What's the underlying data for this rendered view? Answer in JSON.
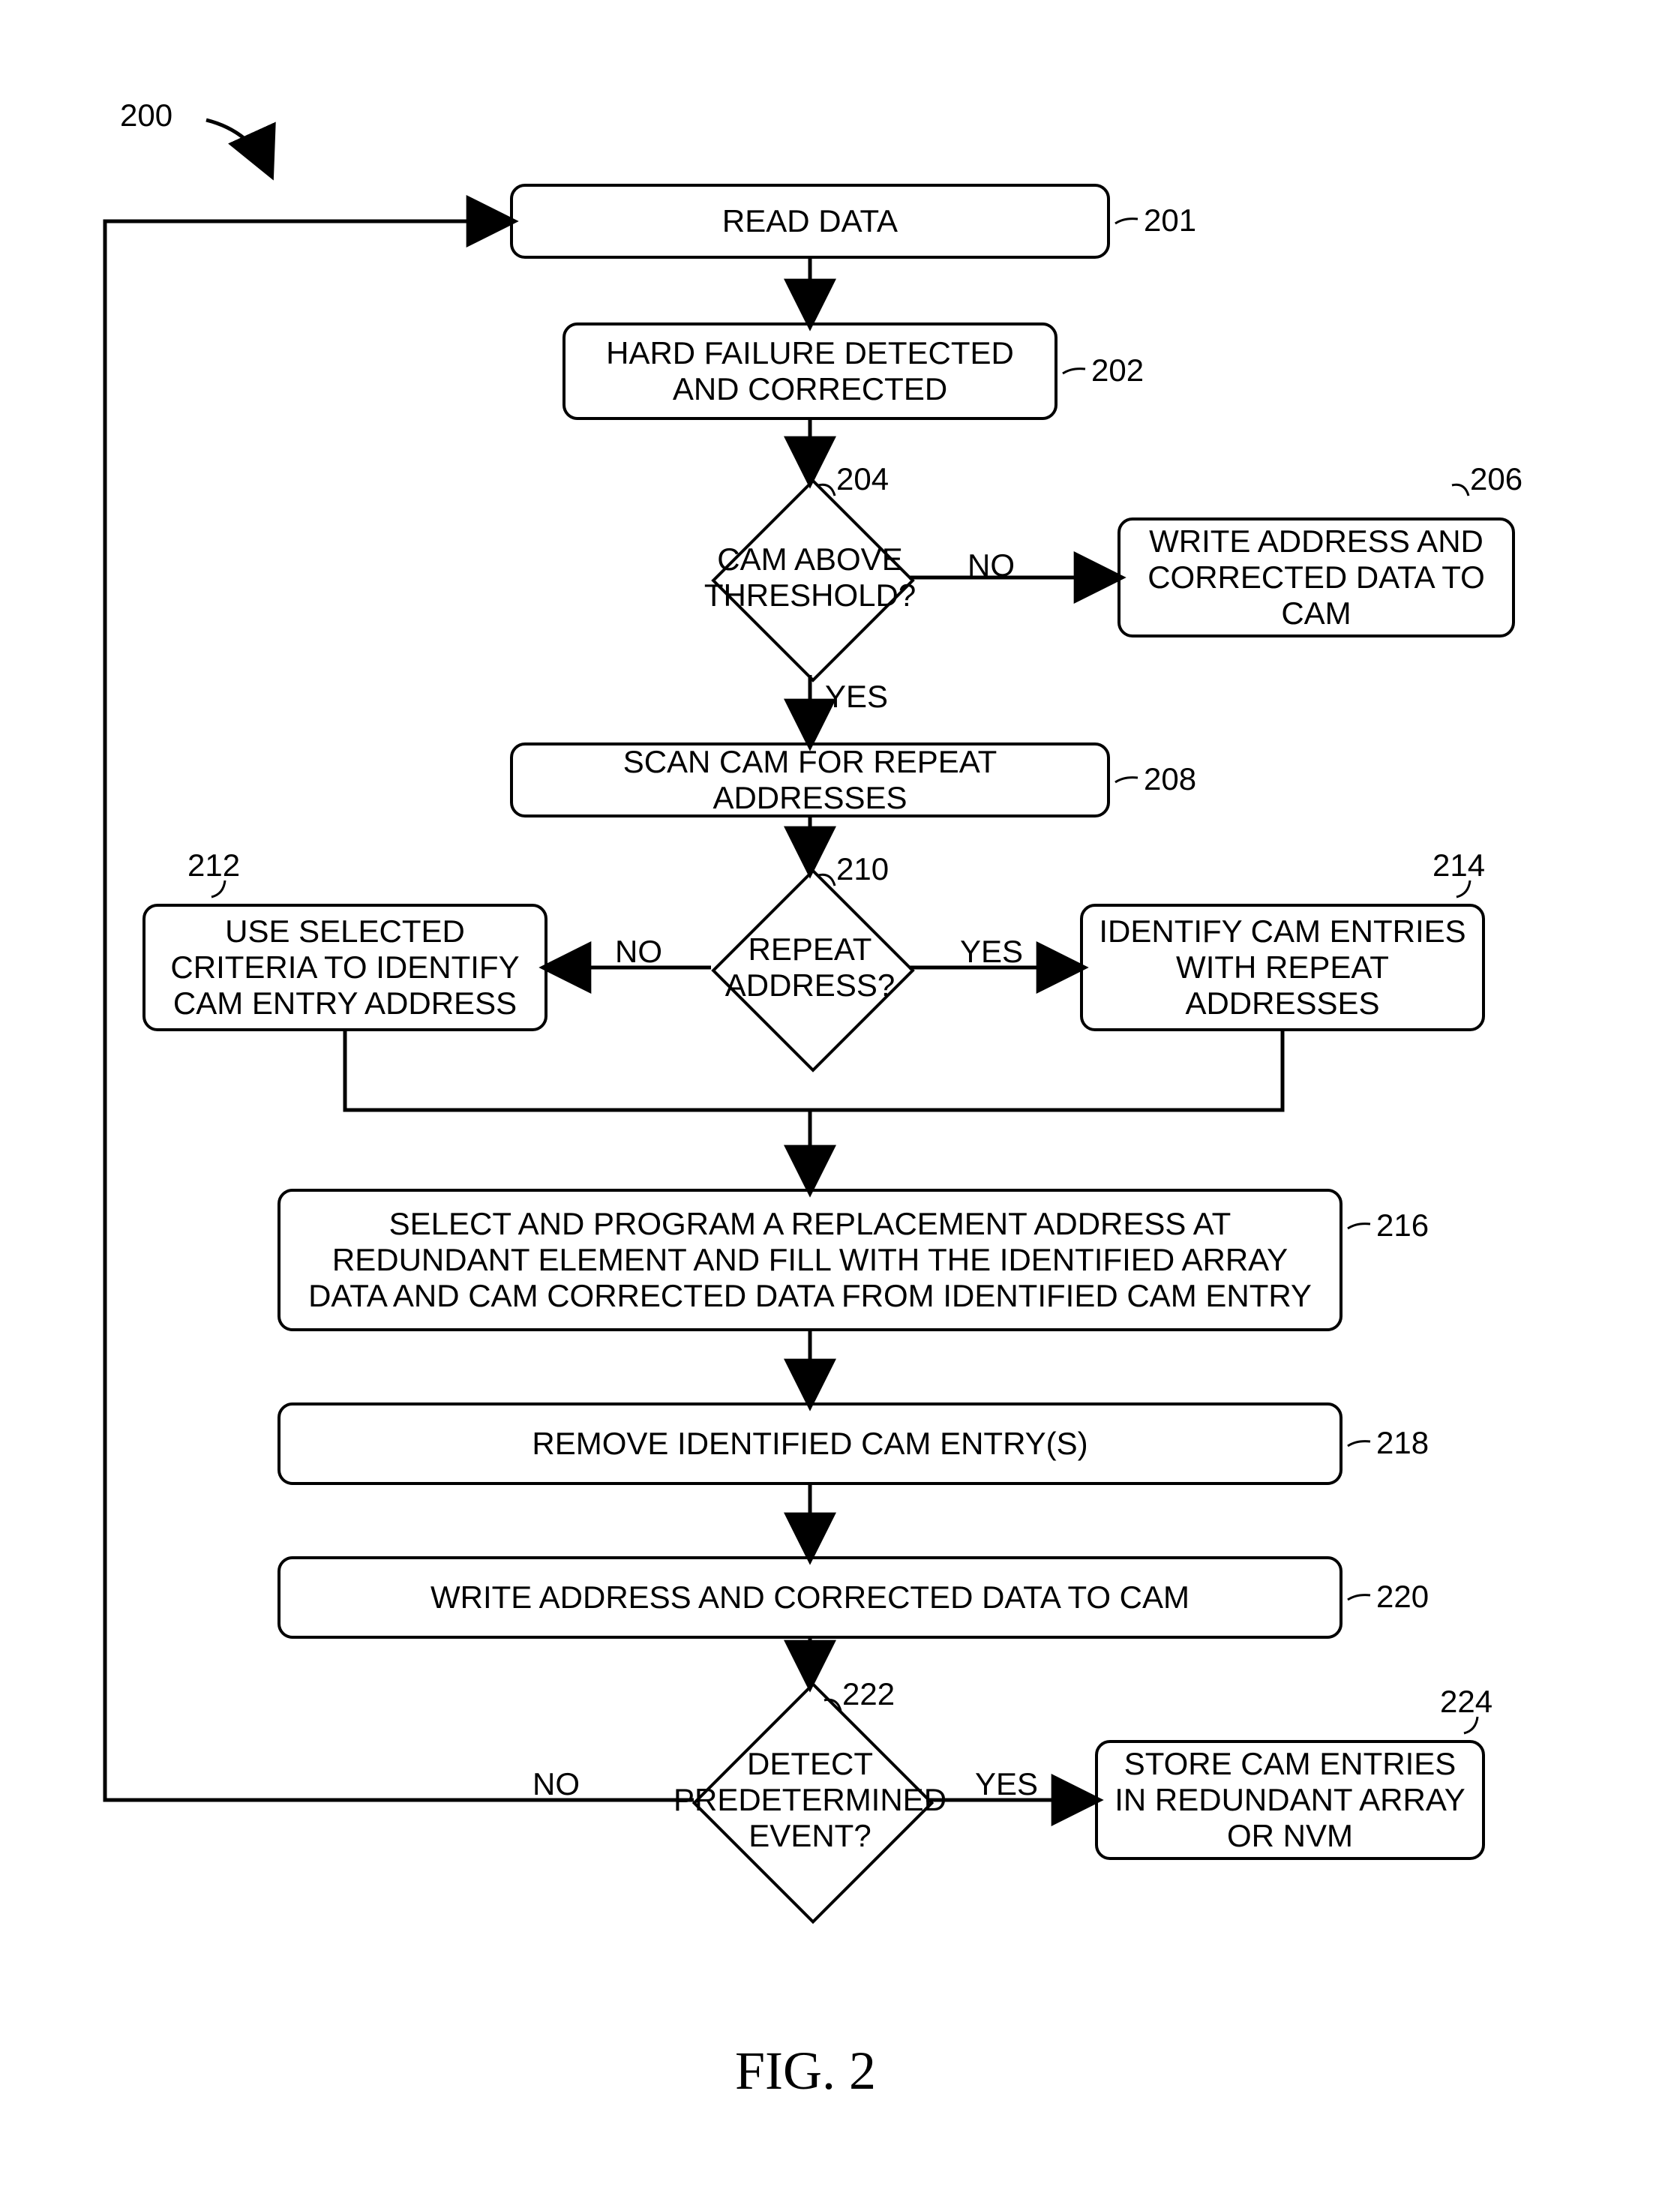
{
  "figure": {
    "number_label": "200",
    "caption": "FIG. 2"
  },
  "nodes": {
    "n201": {
      "text": "READ DATA",
      "ref": "201"
    },
    "n202": {
      "text": "HARD FAILURE DETECTED AND CORRECTED",
      "ref": "202"
    },
    "n204": {
      "text": "CAM ABOVE THRESHOLD?",
      "ref": "204"
    },
    "n206": {
      "text": "WRITE ADDRESS AND CORRECTED DATA TO CAM",
      "ref": "206"
    },
    "n208": {
      "text": "SCAN CAM FOR REPEAT ADDRESSES",
      "ref": "208"
    },
    "n210": {
      "text": "REPEAT ADDRESS?",
      "ref": "210"
    },
    "n212": {
      "text": "USE SELECTED CRITERIA TO IDENTIFY CAM ENTRY ADDRESS",
      "ref": "212"
    },
    "n214": {
      "text": "IDENTIFY CAM ENTRIES WITH REPEAT ADDRESSES",
      "ref": "214"
    },
    "n216": {
      "text": "SELECT AND PROGRAM A REPLACEMENT ADDRESS AT REDUNDANT ELEMENT AND FILL WITH THE IDENTIFIED ARRAY DATA AND CAM CORRECTED DATA FROM IDENTIFIED CAM ENTRY",
      "ref": "216"
    },
    "n218": {
      "text": "REMOVE IDENTIFIED CAM ENTRY(S)",
      "ref": "218"
    },
    "n220": {
      "text": "WRITE ADDRESS AND CORRECTED DATA TO CAM",
      "ref": "220"
    },
    "n222": {
      "text": "DETECT PREDETERMINED EVENT?",
      "ref": "222"
    },
    "n224": {
      "text": "STORE CAM ENTRIES IN REDUNDANT ARRAY OR NVM",
      "ref": "224"
    }
  },
  "labels": {
    "yes": "YES",
    "no": "NO"
  },
  "chart_data": {
    "type": "flowchart",
    "nodes": [
      {
        "id": "201",
        "kind": "process",
        "text": "READ DATA"
      },
      {
        "id": "202",
        "kind": "process",
        "text": "HARD FAILURE DETECTED AND CORRECTED"
      },
      {
        "id": "204",
        "kind": "decision",
        "text": "CAM ABOVE THRESHOLD?"
      },
      {
        "id": "206",
        "kind": "process",
        "text": "WRITE ADDRESS AND CORRECTED DATA TO CAM"
      },
      {
        "id": "208",
        "kind": "process",
        "text": "SCAN CAM FOR REPEAT ADDRESSES"
      },
      {
        "id": "210",
        "kind": "decision",
        "text": "REPEAT ADDRESS?"
      },
      {
        "id": "212",
        "kind": "process",
        "text": "USE SELECTED CRITERIA TO IDENTIFY CAM ENTRY ADDRESS"
      },
      {
        "id": "214",
        "kind": "process",
        "text": "IDENTIFY CAM ENTRIES WITH REPEAT ADDRESSES"
      },
      {
        "id": "216",
        "kind": "process",
        "text": "SELECT AND PROGRAM A REPLACEMENT ADDRESS AT REDUNDANT ELEMENT AND FILL WITH THE IDENTIFIED ARRAY DATA AND CAM CORRECTED DATA FROM IDENTIFIED CAM ENTRY"
      },
      {
        "id": "218",
        "kind": "process",
        "text": "REMOVE IDENTIFIED CAM ENTRY(S)"
      },
      {
        "id": "220",
        "kind": "process",
        "text": "WRITE ADDRESS AND CORRECTED DATA TO CAM"
      },
      {
        "id": "222",
        "kind": "decision",
        "text": "DETECT PREDETERMINED EVENT?"
      },
      {
        "id": "224",
        "kind": "process",
        "text": "STORE CAM ENTRIES IN REDUNDANT ARRAY OR NVM"
      }
    ],
    "edges": [
      {
        "from": "201",
        "to": "202",
        "label": ""
      },
      {
        "from": "202",
        "to": "204",
        "label": ""
      },
      {
        "from": "204",
        "to": "206",
        "label": "NO"
      },
      {
        "from": "204",
        "to": "208",
        "label": "YES"
      },
      {
        "from": "208",
        "to": "210",
        "label": ""
      },
      {
        "from": "210",
        "to": "212",
        "label": "NO"
      },
      {
        "from": "210",
        "to": "214",
        "label": "YES"
      },
      {
        "from": "212",
        "to": "216",
        "label": ""
      },
      {
        "from": "214",
        "to": "216",
        "label": ""
      },
      {
        "from": "216",
        "to": "218",
        "label": ""
      },
      {
        "from": "218",
        "to": "220",
        "label": ""
      },
      {
        "from": "220",
        "to": "222",
        "label": ""
      },
      {
        "from": "222",
        "to": "224",
        "label": "YES"
      },
      {
        "from": "222",
        "to": "201",
        "label": "NO"
      }
    ]
  }
}
